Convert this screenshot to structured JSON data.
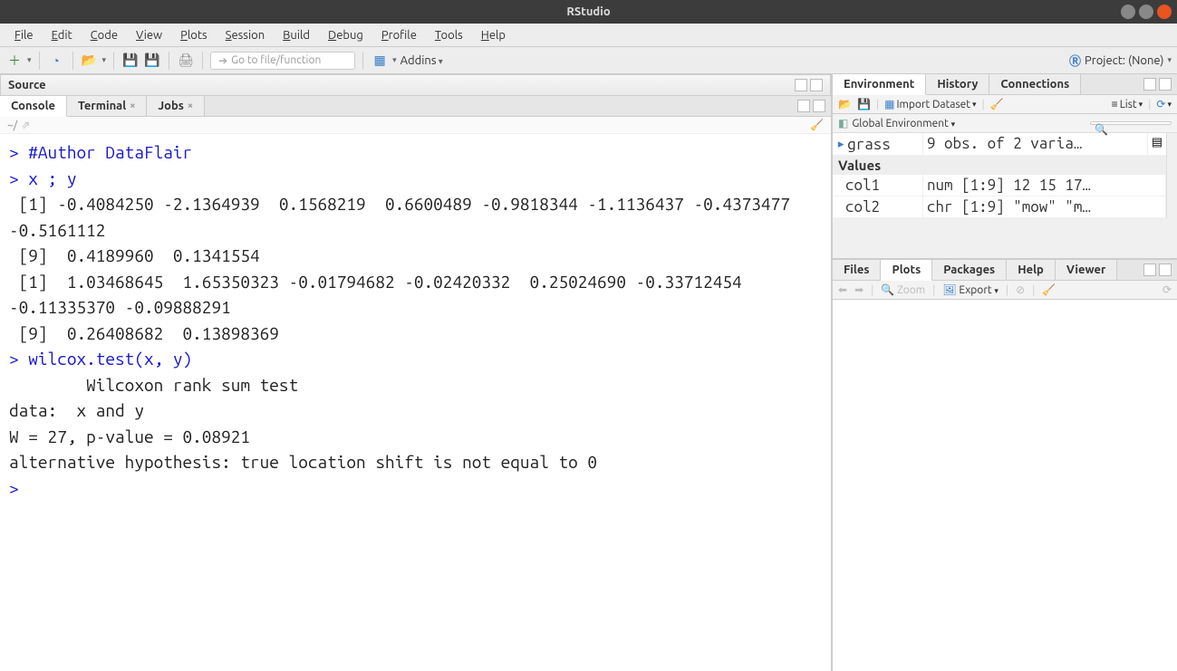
{
  "window": {
    "title": "RStudio"
  },
  "menubar": [
    "File",
    "Edit",
    "Code",
    "View",
    "Plots",
    "Session",
    "Build",
    "Debug",
    "Profile",
    "Tools",
    "Help"
  ],
  "toolbar": {
    "goto_placeholder": "Go to file/function",
    "addins": "Addins",
    "project_label": "Project: (None)"
  },
  "source_pane": {
    "title": "Source"
  },
  "console_pane": {
    "tabs": [
      "Console",
      "Terminal",
      "Jobs"
    ],
    "active_tab": 0,
    "path": "~/",
    "lines": [
      {
        "c": "blue",
        "t": "> #Author DataFlair"
      },
      {
        "c": "blue",
        "t": "> x ; y"
      },
      {
        "c": "black",
        "t": " [1] -0.4084250 -2.1364939  0.1568219  0.6600489 -0.9818344 -1.1136437 -0.4373477 -0.5161112"
      },
      {
        "c": "black",
        "t": " [9]  0.4189960  0.1341554"
      },
      {
        "c": "black",
        "t": " [1]  1.03468645  1.65350323 -0.01794682 -0.02420332  0.25024690 -0.33712454 -0.11335370 -0.09888291"
      },
      {
        "c": "black",
        "t": " [9]  0.26408682  0.13898369"
      },
      {
        "c": "blue",
        "t": "> wilcox.test(x, y)"
      },
      {
        "c": "black",
        "t": ""
      },
      {
        "c": "black",
        "t": "        Wilcoxon rank sum test"
      },
      {
        "c": "black",
        "t": ""
      },
      {
        "c": "black",
        "t": "data:  x and y"
      },
      {
        "c": "black",
        "t": "W = 27, p-value = 0.08921"
      },
      {
        "c": "black",
        "t": "alternative hypothesis: true location shift is not equal to 0"
      },
      {
        "c": "black",
        "t": ""
      },
      {
        "c": "blue",
        "t": "> "
      }
    ]
  },
  "environment_pane": {
    "tabs": [
      "Environment",
      "History",
      "Connections"
    ],
    "active_tab": 0,
    "import_label": "Import Dataset",
    "list_label": "List",
    "scope": "Global Environment",
    "data_rows": [
      {
        "icon": "play",
        "name": "grass",
        "value": "9 obs. of 2 varia…",
        "action": "sheet"
      }
    ],
    "values_header": "Values",
    "value_rows": [
      {
        "name": "col1",
        "value": "num [1:9] 12 15 17…"
      },
      {
        "name": "col2",
        "value": "chr [1:9] \"mow\" \"m…"
      }
    ]
  },
  "plots_pane": {
    "tabs": [
      "Files",
      "Plots",
      "Packages",
      "Help",
      "Viewer"
    ],
    "active_tab": 1,
    "zoom": "Zoom",
    "export": "Export"
  }
}
